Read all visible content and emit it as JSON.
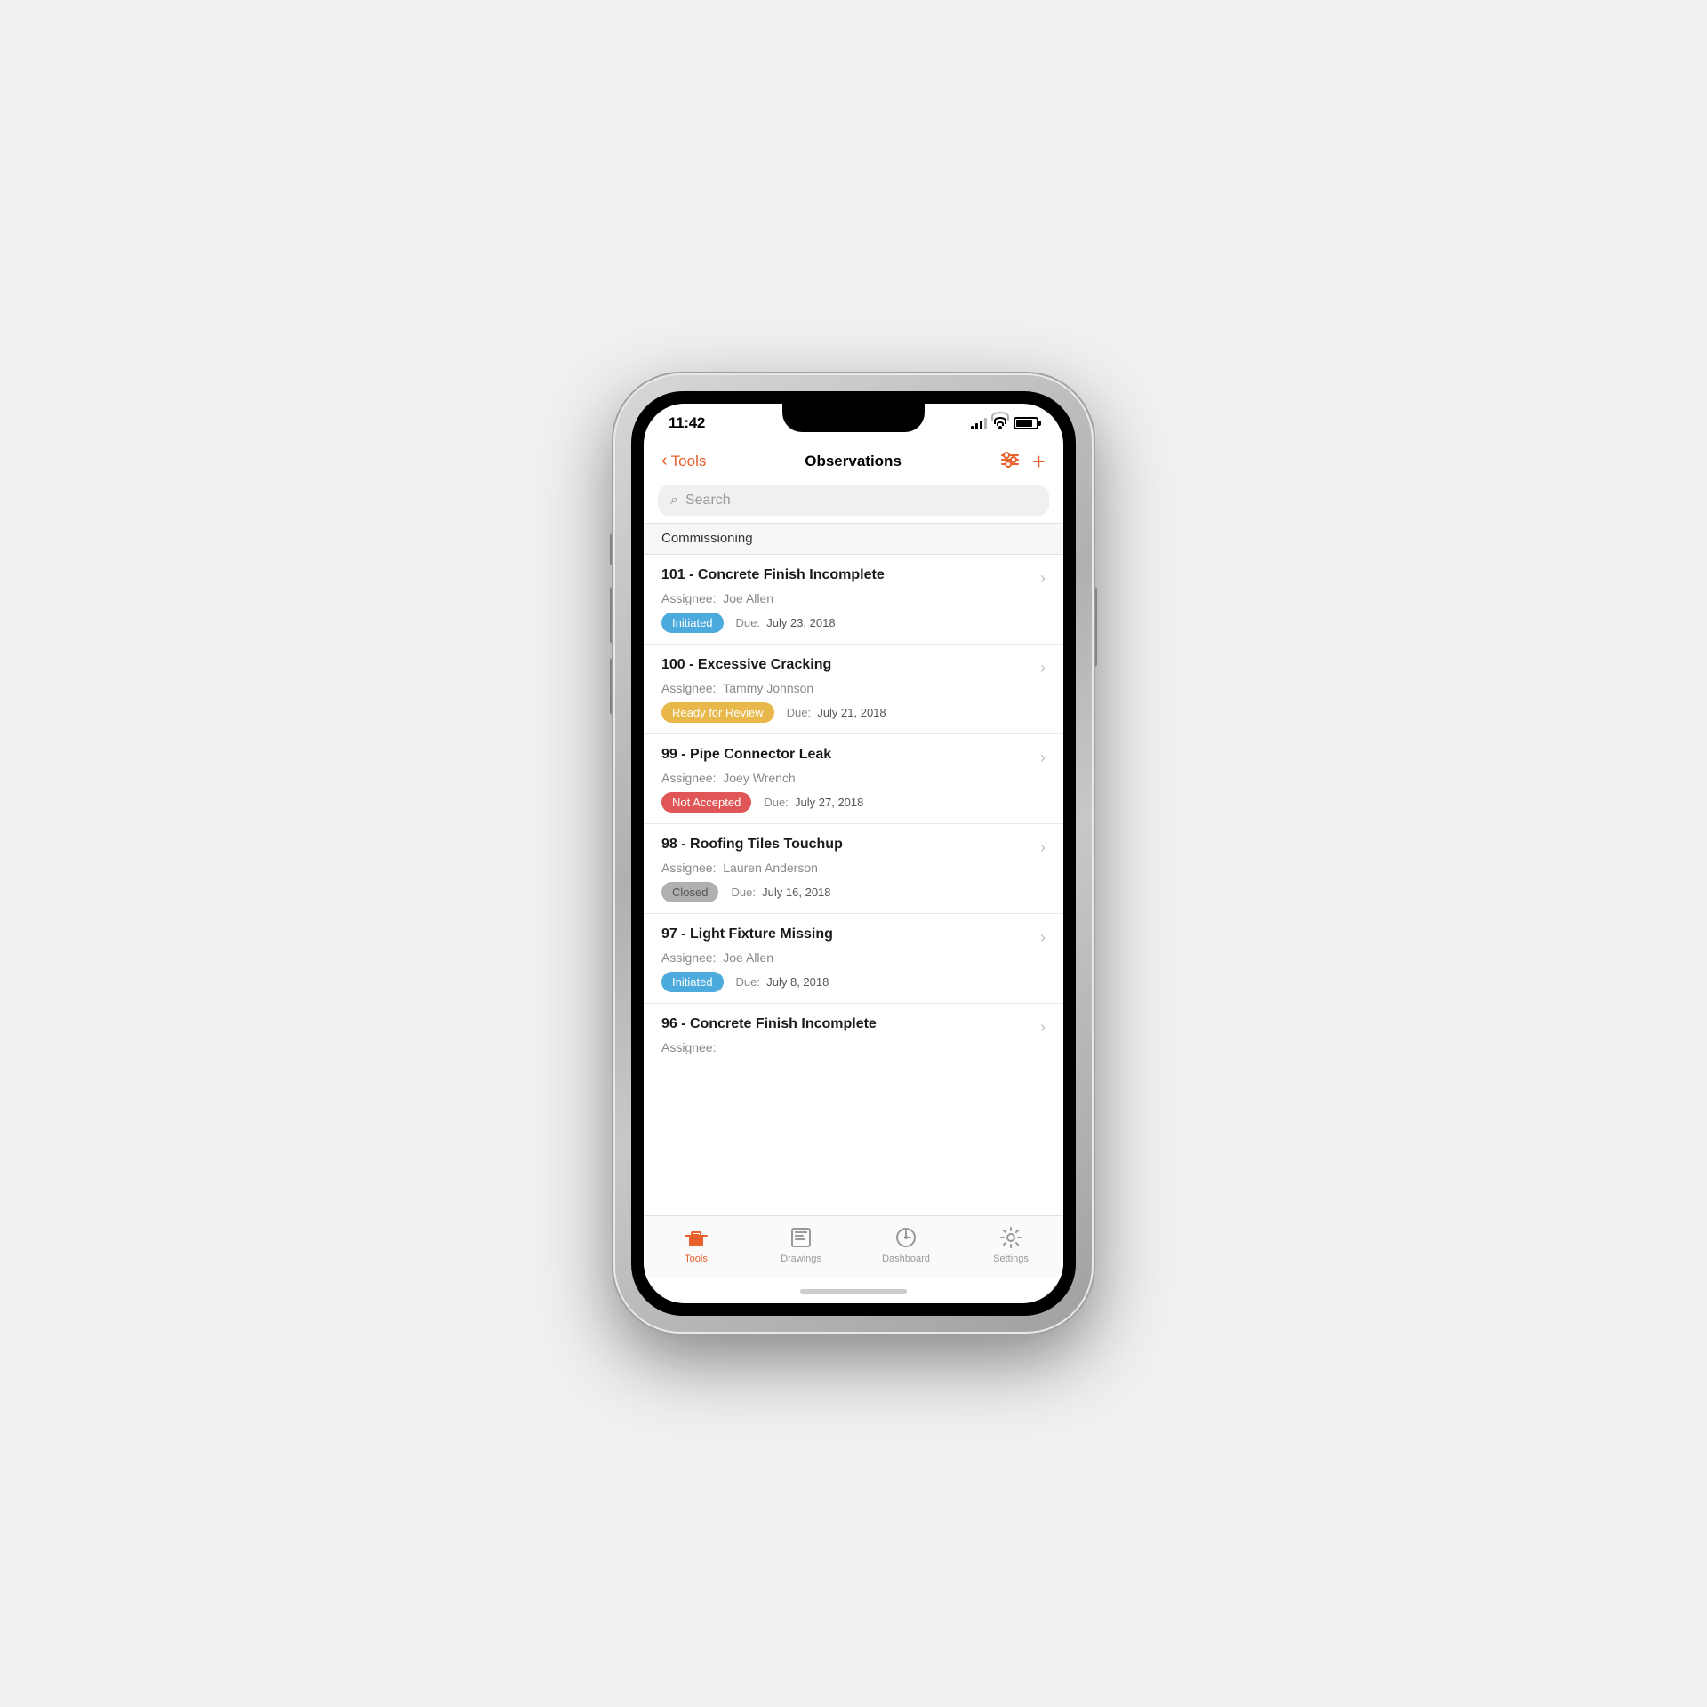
{
  "phone": {
    "status_bar": {
      "time": "11:42"
    },
    "nav": {
      "back_label": "Tools",
      "title": "Observations",
      "add_label": "+"
    },
    "search": {
      "placeholder": "Search"
    },
    "section": {
      "label": "Commissioning"
    },
    "observations": [
      {
        "id": "101",
        "title": "101 - Concrete Finish Incomplete",
        "assignee_label": "Assignee:",
        "assignee": "Joe Allen",
        "status": "Initiated",
        "status_type": "initiated",
        "due_label": "Due:",
        "due_date": "July 23, 2018"
      },
      {
        "id": "100",
        "title": "100 - Excessive Cracking",
        "assignee_label": "Assignee:",
        "assignee": "Tammy Johnson",
        "status": "Ready for Review",
        "status_type": "ready",
        "due_label": "Due:",
        "due_date": "July 21, 2018"
      },
      {
        "id": "99",
        "title": "99 - Pipe Connector Leak",
        "assignee_label": "Assignee:",
        "assignee": "Joey Wrench",
        "status": "Not Accepted",
        "status_type": "not-accepted",
        "due_label": "Due:",
        "due_date": "July 27, 2018"
      },
      {
        "id": "98",
        "title": "98 - Roofing Tiles Touchup",
        "assignee_label": "Assignee:",
        "assignee": "Lauren Anderson",
        "status": "Closed",
        "status_type": "closed",
        "due_label": "Due:",
        "due_date": "July 16, 2018"
      },
      {
        "id": "97",
        "title": "97 - Light Fixture Missing",
        "assignee_label": "Assignee:",
        "assignee": "Joe Allen",
        "status": "Initiated",
        "status_type": "initiated",
        "due_label": "Due:",
        "due_date": "July 8, 2018"
      },
      {
        "id": "96",
        "title": "96 - Concrete Finish Incomplete",
        "assignee_label": "Assignee:",
        "assignee": "",
        "status": "",
        "status_type": "",
        "due_label": "",
        "due_date": ""
      }
    ],
    "tabs": [
      {
        "label": "Tools",
        "active": true,
        "icon": "toolbox"
      },
      {
        "label": "Drawings",
        "active": false,
        "icon": "drawings"
      },
      {
        "label": "Dashboard",
        "active": false,
        "icon": "dashboard"
      },
      {
        "label": "Settings",
        "active": false,
        "icon": "settings"
      }
    ]
  }
}
